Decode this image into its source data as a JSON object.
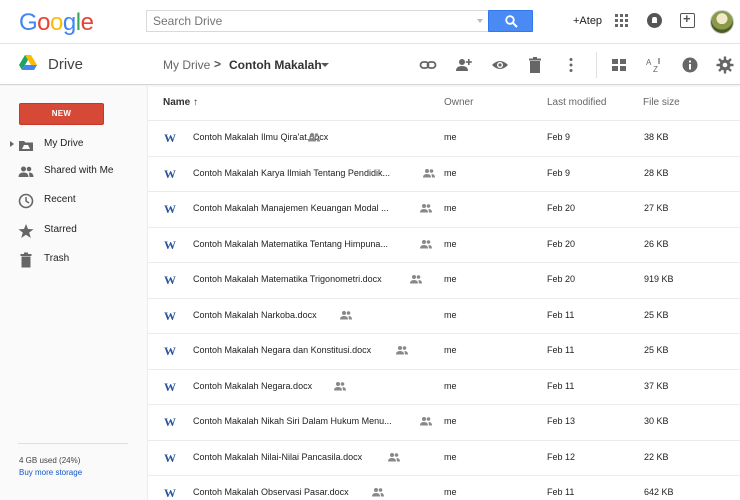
{
  "header": {
    "logo": "Google",
    "logo_colors": [
      "#4285f4",
      "#ea4335",
      "#fbbc05",
      "#4285f4",
      "#34a853",
      "#ea4335"
    ],
    "search_placeholder": "Search Drive",
    "user_link": "+Atep"
  },
  "drivebar": {
    "title": "Drive",
    "breadcrumb_root": "My Drive",
    "breadcrumb_separator": ">",
    "breadcrumb_current": "Contoh Makalah"
  },
  "sidebar": {
    "new_label": "NEW",
    "items": [
      {
        "label": "My Drive",
        "icon": "my-drive-icon"
      },
      {
        "label": "Shared with Me",
        "icon": "people-icon"
      },
      {
        "label": "Recent",
        "icon": "clock-icon"
      },
      {
        "label": "Starred",
        "icon": "star-icon"
      },
      {
        "label": "Trash",
        "icon": "trash-icon"
      }
    ],
    "storage_text": "4 GB used (24%)",
    "storage_link": "Buy more storage"
  },
  "table": {
    "col_name": "Name ↑",
    "col_owner": "Owner",
    "col_modified": "Last modified",
    "col_size": "File size",
    "rows": [
      {
        "icon": "W",
        "name": "Contoh Makalah Ilmu Qira'at.docx",
        "owner": "me",
        "modified": "Feb 9",
        "size": "38 KB"
      },
      {
        "icon": "W",
        "name": "Contoh Makalah Karya Ilmiah Tentang Pendidik...",
        "owner": "me",
        "modified": "Feb 9",
        "size": "28 KB"
      },
      {
        "icon": "W",
        "name": "Contoh Makalah Manajemen Keuangan Modal ...",
        "owner": "me",
        "modified": "Feb 20",
        "size": "27 KB"
      },
      {
        "icon": "W",
        "name": "Contoh Makalah Matematika Tentang Himpuna...",
        "owner": "me",
        "modified": "Feb 20",
        "size": "26 KB"
      },
      {
        "icon": "W",
        "name": "Contoh Makalah Matematika Trigonometri.docx",
        "owner": "me",
        "modified": "Feb 20",
        "size": "919 KB"
      },
      {
        "icon": "W",
        "name": "Contoh Makalah Narkoba.docx",
        "owner": "me",
        "modified": "Feb 11",
        "size": "25 KB"
      },
      {
        "icon": "W",
        "name": "Contoh Makalah Negara dan Konstitusi.docx",
        "owner": "me",
        "modified": "Feb 11",
        "size": "25 KB"
      },
      {
        "icon": "W",
        "name": "Contoh Makalah Negara.docx",
        "owner": "me",
        "modified": "Feb 11",
        "size": "37 KB"
      },
      {
        "icon": "W",
        "name": "Contoh Makalah Nikah Siri Dalam Hukum Menu...",
        "owner": "me",
        "modified": "Feb 13",
        "size": "30 KB"
      },
      {
        "icon": "W",
        "name": "Contoh Makalah Nilai-Nilai Pancasila.docx",
        "owner": "me",
        "modified": "Feb 12",
        "size": "22 KB"
      },
      {
        "icon": "W",
        "name": "Contoh Makalah Observasi Pasar.docx",
        "owner": "me",
        "modified": "Feb 11",
        "size": "642 KB"
      }
    ]
  }
}
